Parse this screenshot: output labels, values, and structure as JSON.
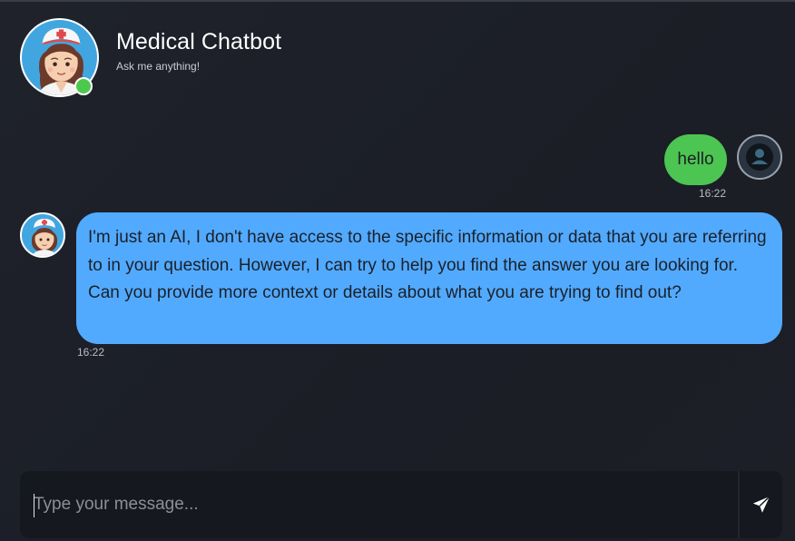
{
  "header": {
    "title": "Medical Chatbot",
    "subtitle": "Ask me anything!",
    "status": "online",
    "bot_avatar_icon": "nurse-avatar-icon"
  },
  "messages": [
    {
      "sender": "user",
      "text": "hello",
      "time": "16:22",
      "avatar_icon": "user-avatar-icon"
    },
    {
      "sender": "bot",
      "text": "I'm just an AI, I don't have access to the specific information or data that you are referring to in your question. However, I can try to help you find the answer you are looking for. Can you provide more context or details about what you are trying to find out?",
      "time": "16:22",
      "avatar_icon": "nurse-avatar-icon"
    }
  ],
  "composer": {
    "placeholder": "Type your message...",
    "value": "",
    "send_icon": "paper-plane-icon"
  },
  "colors": {
    "background": "#1f222b",
    "user_bubble": "#4cc552",
    "bot_bubble": "#52aaff",
    "online": "#4cc94c",
    "input_bg": "#16181f"
  }
}
